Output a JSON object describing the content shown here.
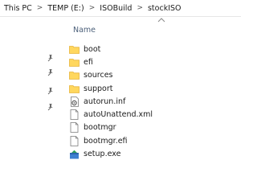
{
  "breadcrumb": {
    "items": [
      "This PC",
      "TEMP (E:)",
      "ISOBuild",
      "stockISO"
    ]
  },
  "columns": {
    "name": "Name"
  },
  "files": [
    {
      "label": "boot",
      "icon": "folder-icon"
    },
    {
      "label": "efi",
      "icon": "folder-icon"
    },
    {
      "label": "sources",
      "icon": "folder-icon"
    },
    {
      "label": "support",
      "icon": "folder-icon"
    },
    {
      "label": "autorun.inf",
      "icon": "settings-file-icon"
    },
    {
      "label": "autoUnattend.xml",
      "icon": "document-icon"
    },
    {
      "label": "bootmgr",
      "icon": "document-icon"
    },
    {
      "label": "bootmgr.efi",
      "icon": "document-icon"
    },
    {
      "label": "setup.exe",
      "icon": "setup-icon"
    }
  ],
  "colors": {
    "folder": "#ffd75e",
    "folder_dark": "#e8b53c",
    "header_text": "#4c607a",
    "pin": "#6b6b6b",
    "setup_green": "#2e9e5b",
    "setup_blue": "#3c7fd0"
  }
}
